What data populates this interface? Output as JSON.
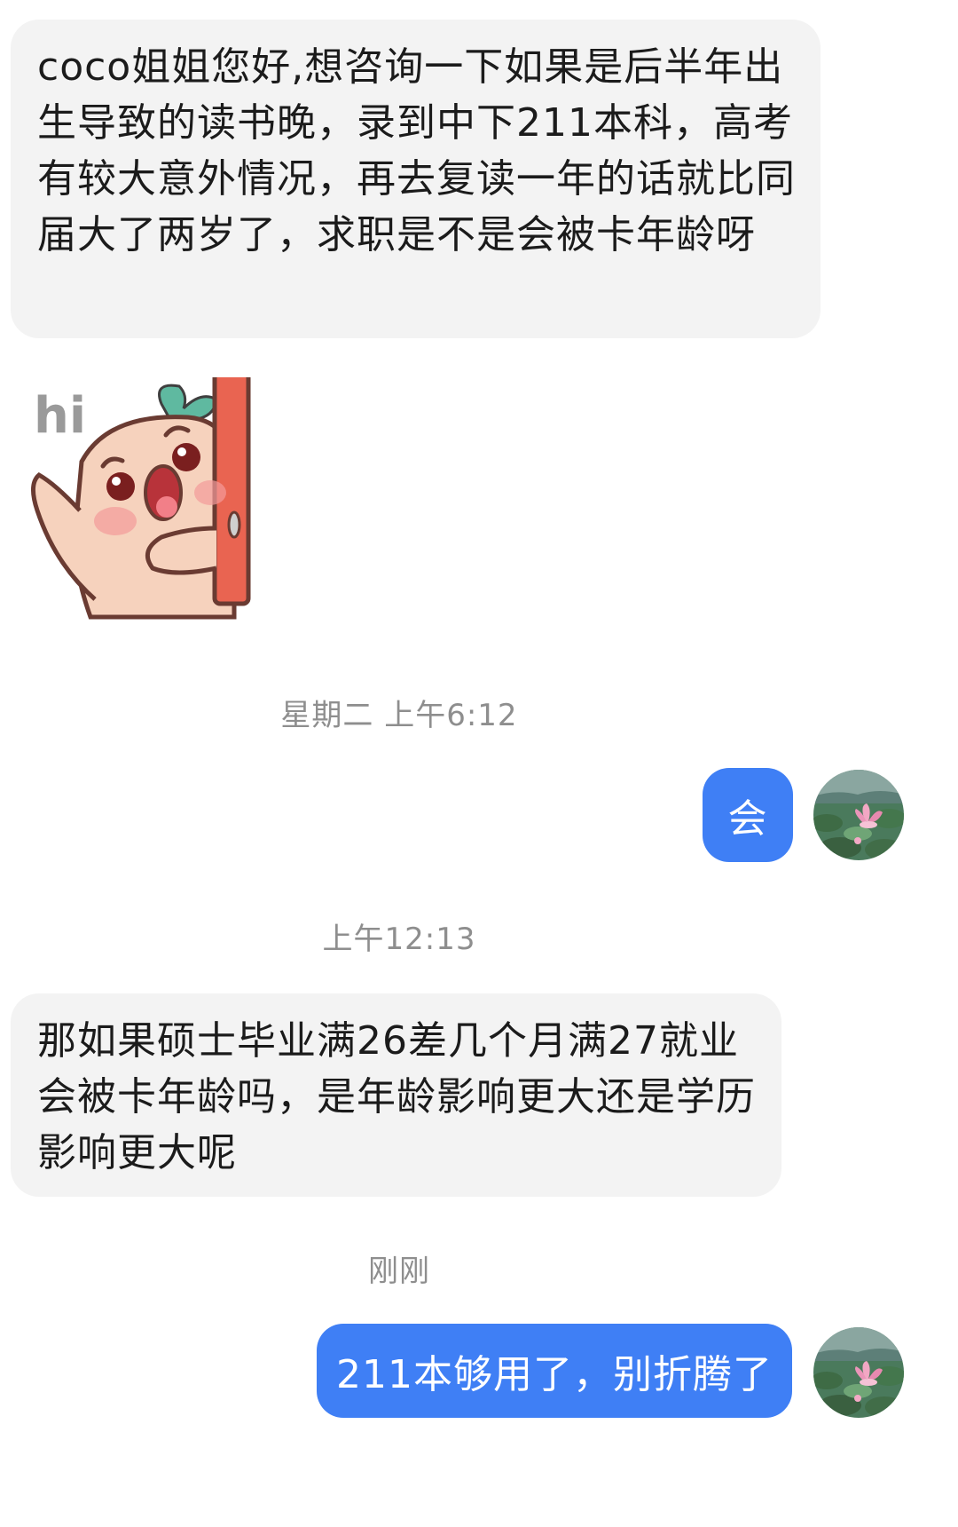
{
  "messages": [
    {
      "id": "msg-1",
      "direction": "incoming",
      "text": "coco姐姐您好,想咨询一下如果是后半年出生导致的读书晚，录到中下211本科，高考有较大意外情况，再去复读一年的话就比同届大了两岁了，求职是不是会被卡年龄呀"
    },
    {
      "id": "sticker",
      "direction": "incoming",
      "type": "sticker",
      "sticker_text": "hi"
    },
    {
      "id": "msg-3",
      "direction": "outgoing",
      "text": "会"
    },
    {
      "id": "msg-2",
      "direction": "incoming",
      "text": "那如果硕士毕业满26差几个月满27就业会被卡年龄吗，是年龄影响更大还是学历影响更大呢"
    },
    {
      "id": "msg-4",
      "direction": "outgoing",
      "text": "211本够用了，别折腾了"
    }
  ],
  "timestamps": {
    "ts1": "星期二 上午6:12",
    "ts2": "上午12:13",
    "ts3": "刚刚"
  },
  "colors": {
    "incoming_bubble": "#f3f3f3",
    "outgoing_bubble": "#3f7ff5",
    "timestamp_text": "#8e8e8e"
  },
  "icons": {
    "avatar": "lotus-pond-avatar",
    "sticker": "peach-character-hi-sticker"
  }
}
